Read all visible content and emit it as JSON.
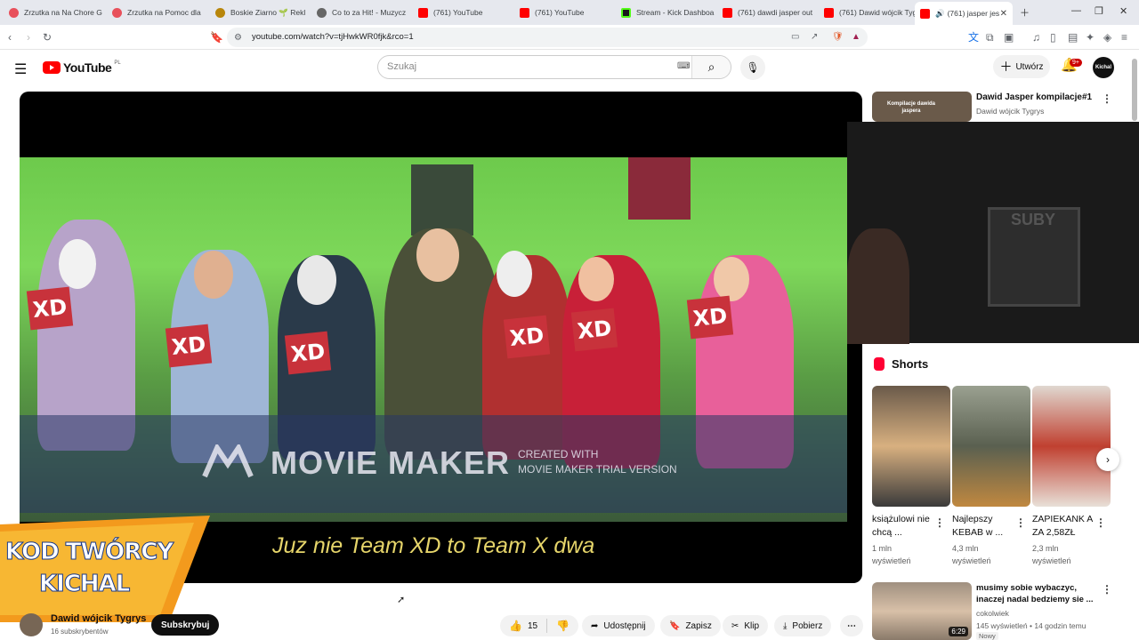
{
  "browser": {
    "tabs": [
      {
        "label": "Zrzutka na Na Chore G",
        "color": "#e8505b"
      },
      {
        "label": "Zrzutka na Pomoc dla",
        "color": "#e8505b"
      },
      {
        "label": "Boskie Ziarno 🌱 Rekl",
        "color": "#b8860b"
      },
      {
        "label": "Co to za Hit! - Muzycz",
        "color": "#666666"
      },
      {
        "label": "(761) YouTube",
        "color": "#ff0000"
      },
      {
        "label": "(761) YouTube",
        "color": "#ff0000"
      },
      {
        "label": "Stream - Kick Dashboa",
        "color": "#53fc18"
      },
      {
        "label": "(761) dawdi jasper out",
        "color": "#ff0000"
      },
      {
        "label": "(761) Dawid wójcik Tyg",
        "color": "#ff0000"
      },
      {
        "label": "(761) jasper jes",
        "color": "#ff0000"
      }
    ],
    "url": "youtube.com/watch?v=tjHwkWR0fjk&rco=1"
  },
  "header": {
    "logo_text": "YouTube",
    "region": "PL",
    "search_placeholder": "Szukaj",
    "create_label": "Utwórz",
    "notif_count": "9+",
    "avatar_text": "Kichal"
  },
  "video": {
    "cards": [
      "XD",
      "XD",
      "XD",
      "XD",
      "XD",
      "XD"
    ],
    "watermark_main": "MOVIE MAKER",
    "watermark_line1": "CREATED WITH",
    "watermark_line2": "MOVIE MAKER TRIAL VERSION",
    "subtitle": "Juz nie Team XD to Team X dwa"
  },
  "promo": {
    "line1": "KOD TWÓRCY",
    "line2": "KICHAL"
  },
  "channel": {
    "name": "Dawid wójcik Tygrys",
    "subs": "16 subskrybentów",
    "subscribe_label": "Subskrybuj"
  },
  "actions": {
    "likes": "15",
    "share": "Udostępnij",
    "save": "Zapisz",
    "clip": "Klip",
    "download": "Pobierz"
  },
  "sidebar": {
    "top_video": {
      "title": "Dawid Jasper kompilacje#1",
      "channel": "Dawid wójcik Tygrys",
      "thumb_text": "Kompilacje dawida jaspera"
    },
    "webcam_board_text": "SUBY",
    "shorts_heading": "Shorts",
    "shorts": [
      {
        "title": "książulowi nie chcą ...",
        "views": "1 mln",
        "views2": "wyświetleń"
      },
      {
        "title": "Najlepszy KEBAB w ...",
        "views": "4,3 mln",
        "views2": "wyświetleń"
      },
      {
        "title": "ZAPIEKANK A ZA 2,58ZŁ",
        "views": "2,3 mln",
        "views2": "wyświetleń"
      }
    ],
    "bottom_video": {
      "title": "musimy sobie wybaczyc, inaczej nadal bedziemy sie ...",
      "channel": "cokolwiek",
      "meta": "145 wyświetleń • 14 godzin temu",
      "badge": "Nowy",
      "duration": "6:29"
    }
  }
}
